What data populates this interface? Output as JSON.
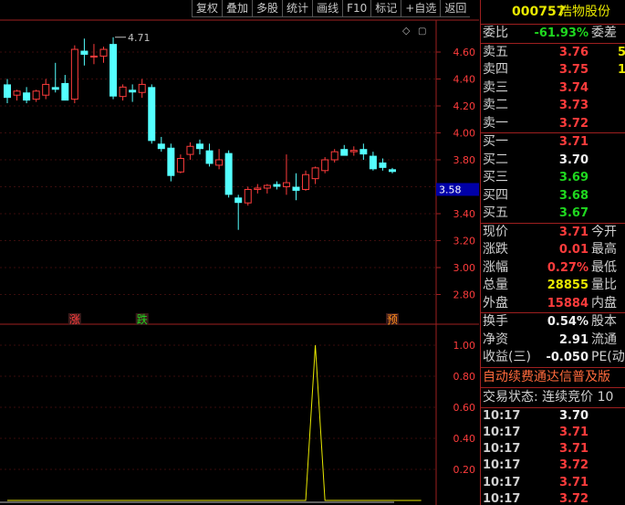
{
  "toolbar": [
    "复权",
    "叠加",
    "多股",
    "统计",
    "画线",
    "F10",
    "标记",
    "+自选",
    "返回"
  ],
  "stock": {
    "code": "000757",
    "name": "浩物股份"
  },
  "weibi": {
    "label": "委比",
    "value": "-61.93%",
    "ext": "委差"
  },
  "asks": [
    {
      "label": "卖五",
      "price": "3.76",
      "vol": "5"
    },
    {
      "label": "卖四",
      "price": "3.75",
      "vol": "1"
    },
    {
      "label": "卖三",
      "price": "3.74",
      "vol": ""
    },
    {
      "label": "卖二",
      "price": "3.73",
      "vol": ""
    },
    {
      "label": "卖一",
      "price": "3.72",
      "vol": ""
    }
  ],
  "bids": [
    {
      "label": "买一",
      "price": "3.71",
      "color": "red"
    },
    {
      "label": "买二",
      "price": "3.70",
      "color": "white"
    },
    {
      "label": "买三",
      "price": "3.69",
      "color": "green"
    },
    {
      "label": "买四",
      "price": "3.68",
      "color": "green"
    },
    {
      "label": "买五",
      "price": "3.67",
      "color": "green"
    }
  ],
  "quote": [
    {
      "label": "现价",
      "value": "3.71",
      "color": "red",
      "ext": "今开"
    },
    {
      "label": "涨跌",
      "value": "0.01",
      "color": "red",
      "ext": "最高"
    },
    {
      "label": "涨幅",
      "value": "0.27%",
      "color": "red",
      "ext": "最低"
    },
    {
      "label": "总量",
      "value": "28855",
      "color": "yellow",
      "ext": "量比"
    },
    {
      "label": "外盘",
      "value": "15884",
      "color": "red",
      "ext": "内盘"
    }
  ],
  "fund": [
    {
      "label": "换手",
      "value": "0.54%",
      "ext": "股本"
    },
    {
      "label": "净资",
      "value": "2.91",
      "ext": "流通"
    },
    {
      "label": "收益(三)",
      "value": "-0.050",
      "ext": "PE(动)"
    }
  ],
  "banner": "自动续费通达信普及版",
  "trade_state": "交易状态: 连续竞价 10",
  "ticks": [
    {
      "time": "10:17",
      "price": "3.70",
      "color": "white"
    },
    {
      "time": "10:17",
      "price": "3.71",
      "color": "red"
    },
    {
      "time": "10:17",
      "price": "3.71",
      "color": "red"
    },
    {
      "time": "10:17",
      "price": "3.72",
      "color": "red"
    },
    {
      "time": "10:17",
      "price": "3.71",
      "color": "red"
    },
    {
      "time": "10:17",
      "price": "3.72",
      "color": "red"
    }
  ],
  "chart_data": {
    "type": "candlestick",
    "price_axis": [
      4.6,
      4.4,
      4.2,
      4.0,
      3.8,
      3.6,
      3.4,
      3.2,
      3.0,
      2.8
    ],
    "current_price_tag": "3.58",
    "high_marker": "4.71",
    "signal_labels": [
      {
        "text": "涨",
        "bar": 7,
        "color": "#ff3c3c"
      },
      {
        "text": "跌",
        "bar": 14,
        "color": "#1fd81f"
      },
      {
        "text": "预",
        "bar": 40,
        "color": "#ff8c1a"
      }
    ],
    "indicator_axis": [
      "1.00",
      "0.80",
      "0.60",
      "0.40",
      "0.20"
    ],
    "indicator_series": [
      0,
      0,
      0,
      0,
      0,
      0,
      0,
      0,
      0,
      0,
      0,
      0,
      0,
      0,
      0,
      0,
      0,
      0,
      0,
      0,
      0,
      0,
      0,
      0,
      0,
      0,
      0,
      0,
      0,
      0,
      0,
      0,
      1.0,
      0,
      0,
      0,
      0,
      0,
      0,
      0,
      0,
      0,
      0,
      0
    ],
    "candles": [
      {
        "o": 4.36,
        "h": 4.4,
        "l": 4.22,
        "c": 4.26
      },
      {
        "o": 4.28,
        "h": 4.32,
        "l": 4.24,
        "c": 4.31
      },
      {
        "o": 4.3,
        "h": 4.34,
        "l": 4.22,
        "c": 4.24
      },
      {
        "o": 4.25,
        "h": 4.32,
        "l": 4.23,
        "c": 4.31
      },
      {
        "o": 4.28,
        "h": 4.4,
        "l": 4.25,
        "c": 4.36
      },
      {
        "o": 4.34,
        "h": 4.52,
        "l": 4.3,
        "c": 4.32
      },
      {
        "o": 4.37,
        "h": 4.43,
        "l": 4.26,
        "c": 4.24
      },
      {
        "o": 4.25,
        "h": 4.65,
        "l": 4.22,
        "c": 4.62
      },
      {
        "o": 4.61,
        "h": 4.7,
        "l": 4.5,
        "c": 4.58
      },
      {
        "o": 4.57,
        "h": 4.66,
        "l": 4.51,
        "c": 4.57
      },
      {
        "o": 4.57,
        "h": 4.64,
        "l": 4.52,
        "c": 4.62
      },
      {
        "o": 4.66,
        "h": 4.71,
        "l": 4.25,
        "c": 4.27
      },
      {
        "o": 4.27,
        "h": 4.36,
        "l": 4.24,
        "c": 4.34
      },
      {
        "o": 4.32,
        "h": 4.36,
        "l": 4.23,
        "c": 4.3
      },
      {
        "o": 4.3,
        "h": 4.4,
        "l": 4.26,
        "c": 4.36
      },
      {
        "o": 4.34,
        "h": 4.36,
        "l": 3.92,
        "c": 3.94
      },
      {
        "o": 3.92,
        "h": 3.97,
        "l": 3.86,
        "c": 3.88
      },
      {
        "o": 3.89,
        "h": 3.92,
        "l": 3.64,
        "c": 3.68
      },
      {
        "o": 3.71,
        "h": 3.84,
        "l": 3.7,
        "c": 3.81
      },
      {
        "o": 3.84,
        "h": 3.93,
        "l": 3.8,
        "c": 3.9
      },
      {
        "o": 3.92,
        "h": 3.95,
        "l": 3.84,
        "c": 3.88
      },
      {
        "o": 3.87,
        "h": 3.92,
        "l": 3.75,
        "c": 3.77
      },
      {
        "o": 3.76,
        "h": 3.88,
        "l": 3.73,
        "c": 3.8
      },
      {
        "o": 3.85,
        "h": 3.87,
        "l": 3.52,
        "c": 3.54
      },
      {
        "o": 3.52,
        "h": 3.54,
        "l": 3.28,
        "c": 3.48
      },
      {
        "o": 3.48,
        "h": 3.6,
        "l": 3.46,
        "c": 3.58
      },
      {
        "o": 3.58,
        "h": 3.62,
        "l": 3.55,
        "c": 3.59
      },
      {
        "o": 3.59,
        "h": 3.62,
        "l": 3.55,
        "c": 3.61
      },
      {
        "o": 3.62,
        "h": 3.64,
        "l": 3.58,
        "c": 3.6
      },
      {
        "o": 3.6,
        "h": 3.84,
        "l": 3.54,
        "c": 3.63
      },
      {
        "o": 3.6,
        "h": 3.7,
        "l": 3.5,
        "c": 3.57
      },
      {
        "o": 3.58,
        "h": 3.72,
        "l": 3.57,
        "c": 3.69
      },
      {
        "o": 3.66,
        "h": 3.75,
        "l": 3.62,
        "c": 3.74
      },
      {
        "o": 3.72,
        "h": 3.82,
        "l": 3.7,
        "c": 3.8
      },
      {
        "o": 3.8,
        "h": 3.88,
        "l": 3.78,
        "c": 3.86
      },
      {
        "o": 3.88,
        "h": 3.91,
        "l": 3.84,
        "c": 3.83
      },
      {
        "o": 3.86,
        "h": 3.9,
        "l": 3.83,
        "c": 3.87
      },
      {
        "o": 3.88,
        "h": 3.92,
        "l": 3.8,
        "c": 3.84
      },
      {
        "o": 3.83,
        "h": 3.86,
        "l": 3.72,
        "c": 3.73
      },
      {
        "o": 3.78,
        "h": 3.81,
        "l": 3.72,
        "c": 3.74
      },
      {
        "o": 3.73,
        "h": 3.74,
        "l": 3.7,
        "c": 3.71
      }
    ]
  }
}
